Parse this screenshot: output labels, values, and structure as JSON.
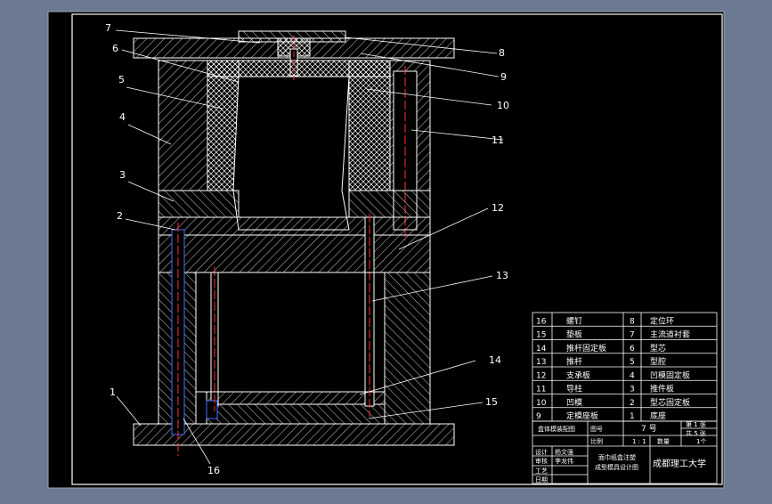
{
  "callouts": {
    "c1": "1",
    "c2": "2",
    "c3": "3",
    "c4": "4",
    "c5": "5",
    "c6": "6",
    "c7": "7",
    "c8": "8",
    "c9": "9",
    "c10": "10",
    "c11": "11",
    "c12": "12",
    "c13": "13",
    "c14": "14",
    "c15": "15",
    "c16": "16"
  },
  "parts_list": [
    {
      "no": "16",
      "name": "螺钉",
      "no2": "8",
      "name2": "定位环"
    },
    {
      "no": "15",
      "name": "垫板",
      "no2": "7",
      "name2": "主流道衬套"
    },
    {
      "no": "14",
      "name": "推杆固定板",
      "no2": "6",
      "name2": "型芯"
    },
    {
      "no": "13",
      "name": "推杆",
      "no2": "5",
      "name2": "型腔"
    },
    {
      "no": "12",
      "name": "支承板",
      "no2": "4",
      "name2": "凹模固定板"
    },
    {
      "no": "11",
      "name": "导柱",
      "no2": "3",
      "name2": "推件板"
    },
    {
      "no": "10",
      "name": "凹模",
      "no2": "2",
      "name2": "型芯固定板"
    },
    {
      "no": "9",
      "name": "定模座板",
      "no2": "1",
      "name2": "底座"
    }
  ],
  "title_block": {
    "assembly": "盒体模装配图",
    "drawing_no_label": "图号",
    "drawing_no": "7 号",
    "sheet1": "第 1 张",
    "sheet2": "共 5 张",
    "scale_label": "比例",
    "scale": "1 : 1",
    "qty_label": "数量",
    "qty": "1个",
    "designer_label": "设计",
    "designer": "杨文强",
    "checker_label": "审核",
    "checker": "李龙伟",
    "process_label": "工艺",
    "date_label": "日期",
    "subject_line1": "面巾纸盒注塑",
    "subject_line2": "成型模具设计图",
    "school": "成都理工大学"
  },
  "colors": {
    "background": "#6b7a92",
    "paper": "#000000",
    "lines": "#ffffff",
    "pins": "#4a6cff",
    "centerlines": "#ff3030",
    "hatch": "#ffffff"
  }
}
